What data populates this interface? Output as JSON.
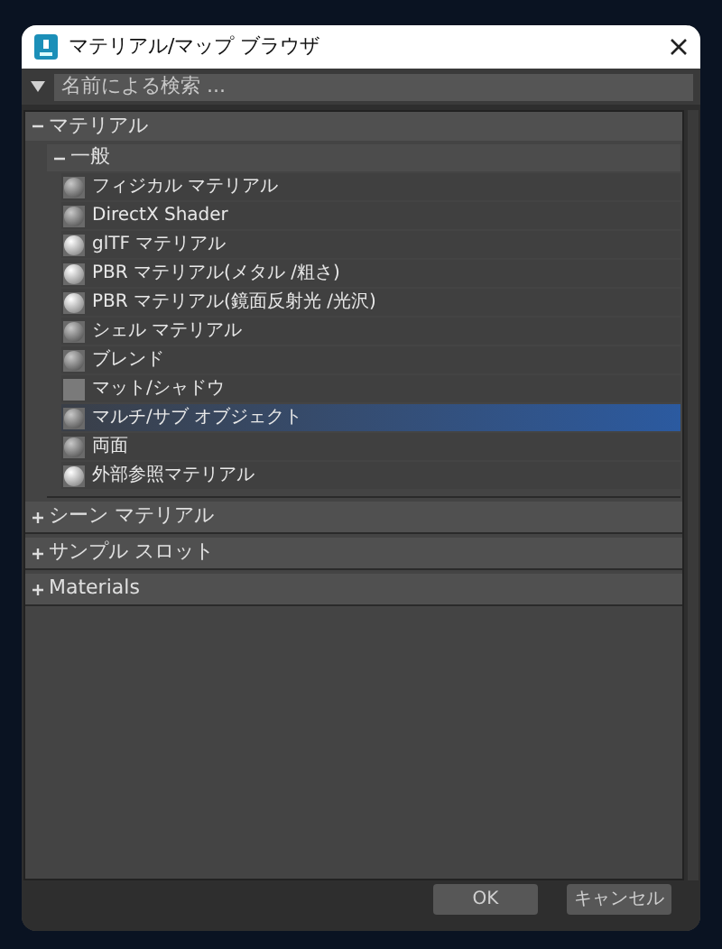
{
  "window": {
    "title": "マテリアル/マップ ブラウザ"
  },
  "search": {
    "placeholder": "名前による検索 ..."
  },
  "categories": [
    {
      "label": "マテリアル",
      "expanded": true,
      "groups": [
        {
          "label": "一般",
          "expanded": true,
          "items": [
            {
              "label": "フィジカル マテリアル",
              "kind": "sphere_dark",
              "selected": false
            },
            {
              "label": "DirectX Shader",
              "kind": "sphere_dark",
              "selected": false
            },
            {
              "label": "glTF マテリアル",
              "kind": "sphere_light",
              "selected": false
            },
            {
              "label": "PBR マテリアル(メタル /粗さ)",
              "kind": "sphere_light",
              "selected": false
            },
            {
              "label": "PBR マテリアル(鏡面反射光 /光沢)",
              "kind": "sphere_light",
              "selected": false
            },
            {
              "label": "シェル マテリアル",
              "kind": "sphere_dark",
              "selected": false
            },
            {
              "label": "ブレンド",
              "kind": "sphere_dark",
              "selected": false
            },
            {
              "label": "マット/シャドウ",
              "kind": "flat",
              "selected": false
            },
            {
              "label": "マルチ/サブ オブジェクト",
              "kind": "sphere_dark",
              "selected": true
            },
            {
              "label": "両面",
              "kind": "sphere_dark",
              "selected": false
            },
            {
              "label": "外部参照マテリアル",
              "kind": "sphere_light",
              "selected": false
            }
          ]
        }
      ]
    },
    {
      "label": "シーン マテリアル",
      "expanded": false
    },
    {
      "label": "サンプル スロット",
      "expanded": false
    },
    {
      "label": "Materials",
      "expanded": false
    }
  ],
  "buttons": [
    "OK",
    "キャンセル"
  ]
}
